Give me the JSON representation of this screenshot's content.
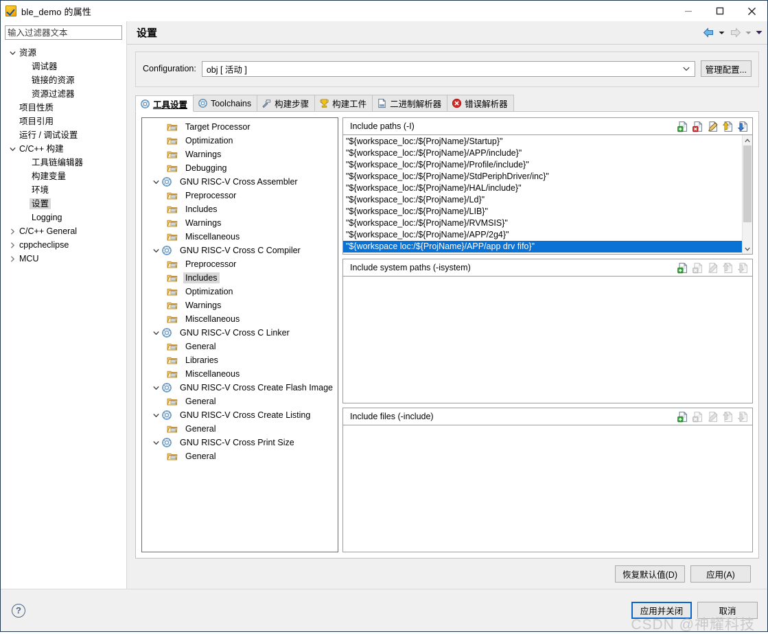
{
  "window": {
    "title": "ble_demo 的属性",
    "app_icon": "checkbox-yellow-icon",
    "minimize_label": "最小化",
    "maximize_label": "最大化",
    "close_label": "关闭"
  },
  "sidebar": {
    "filter_placeholder": "输入过滤器文本",
    "filter_value": "",
    "items": [
      {
        "label": "资源",
        "depth": 0,
        "arrow": "down",
        "selected": false
      },
      {
        "label": "调试器",
        "depth": 1,
        "arrow": "none",
        "selected": false
      },
      {
        "label": "链接的资源",
        "depth": 1,
        "arrow": "none",
        "selected": false
      },
      {
        "label": "资源过滤器",
        "depth": 1,
        "arrow": "none",
        "selected": false
      },
      {
        "label": "项目性质",
        "depth": 0,
        "arrow": "none",
        "selected": false
      },
      {
        "label": "项目引用",
        "depth": 0,
        "arrow": "none",
        "selected": false
      },
      {
        "label": "运行 / 调试设置",
        "depth": 0,
        "arrow": "none",
        "selected": false
      },
      {
        "label": "C/C++ 构建",
        "depth": 0,
        "arrow": "down",
        "selected": false
      },
      {
        "label": "工具链编辑器",
        "depth": 1,
        "arrow": "none",
        "selected": false
      },
      {
        "label": "构建变量",
        "depth": 1,
        "arrow": "none",
        "selected": false
      },
      {
        "label": "环境",
        "depth": 1,
        "arrow": "none",
        "selected": false
      },
      {
        "label": "设置",
        "depth": 1,
        "arrow": "none",
        "selected": true
      },
      {
        "label": "Logging",
        "depth": 1,
        "arrow": "none",
        "selected": false
      },
      {
        "label": "C/C++ General",
        "depth": 0,
        "arrow": "right",
        "selected": false
      },
      {
        "label": "cppcheclipse",
        "depth": 0,
        "arrow": "right",
        "selected": false
      },
      {
        "label": "MCU",
        "depth": 0,
        "arrow": "right",
        "selected": false
      }
    ]
  },
  "page": {
    "title": "设置",
    "nav_back": "back-arrow-icon",
    "nav_forward": "forward-arrow-icon",
    "nav_menu": "dropdown-caret-icon"
  },
  "configuration": {
    "label": "Configuration:",
    "value": "obj  [ 活动 ]",
    "manage_label": "管理配置..."
  },
  "tabs": [
    {
      "label": "工具设置",
      "icon": "gear-wrench-icon",
      "active": true
    },
    {
      "label": "Toolchains",
      "icon": "gear-wrench-icon",
      "active": false
    },
    {
      "label": "构建步骤",
      "icon": "hammer-icon",
      "active": false
    },
    {
      "label": "构建工件",
      "icon": "trophy-icon",
      "active": false
    },
    {
      "label": "二进制解析器",
      "icon": "binary-file-icon",
      "active": false
    },
    {
      "label": "错误解析器",
      "icon": "error-circle-icon",
      "active": false
    }
  ],
  "tool_tree": [
    {
      "label": "Target Processor",
      "depth": 1,
      "icon": "folder-icon",
      "twisty": "none",
      "selected": false
    },
    {
      "label": "Optimization",
      "depth": 1,
      "icon": "folder-icon",
      "twisty": "none",
      "selected": false
    },
    {
      "label": "Warnings",
      "depth": 1,
      "icon": "folder-icon",
      "twisty": "none",
      "selected": false
    },
    {
      "label": "Debugging",
      "depth": 1,
      "icon": "folder-icon",
      "twisty": "none",
      "selected": false
    },
    {
      "label": "GNU RISC-V Cross Assembler",
      "depth": 0,
      "icon": "gear-wrench-icon",
      "twisty": "down",
      "selected": false
    },
    {
      "label": "Preprocessor",
      "depth": 1,
      "icon": "folder-icon",
      "twisty": "none",
      "selected": false
    },
    {
      "label": "Includes",
      "depth": 1,
      "icon": "folder-icon",
      "twisty": "none",
      "selected": false
    },
    {
      "label": "Warnings",
      "depth": 1,
      "icon": "folder-icon",
      "twisty": "none",
      "selected": false
    },
    {
      "label": "Miscellaneous",
      "depth": 1,
      "icon": "folder-icon",
      "twisty": "none",
      "selected": false
    },
    {
      "label": "GNU RISC-V Cross C Compiler",
      "depth": 0,
      "icon": "gear-wrench-icon",
      "twisty": "down",
      "selected": false
    },
    {
      "label": "Preprocessor",
      "depth": 1,
      "icon": "folder-icon",
      "twisty": "none",
      "selected": false
    },
    {
      "label": "Includes",
      "depth": 1,
      "icon": "folder-icon",
      "twisty": "none",
      "selected": true
    },
    {
      "label": "Optimization",
      "depth": 1,
      "icon": "folder-icon",
      "twisty": "none",
      "selected": false
    },
    {
      "label": "Warnings",
      "depth": 1,
      "icon": "folder-icon",
      "twisty": "none",
      "selected": false
    },
    {
      "label": "Miscellaneous",
      "depth": 1,
      "icon": "folder-icon",
      "twisty": "none",
      "selected": false
    },
    {
      "label": "GNU RISC-V Cross C Linker",
      "depth": 0,
      "icon": "gear-wrench-icon",
      "twisty": "down",
      "selected": false
    },
    {
      "label": "General",
      "depth": 1,
      "icon": "folder-icon",
      "twisty": "none",
      "selected": false
    },
    {
      "label": "Libraries",
      "depth": 1,
      "icon": "folder-icon",
      "twisty": "none",
      "selected": false
    },
    {
      "label": "Miscellaneous",
      "depth": 1,
      "icon": "folder-icon",
      "twisty": "none",
      "selected": false
    },
    {
      "label": "GNU RISC-V Cross Create Flash Image",
      "depth": 0,
      "icon": "gear-wrench-icon",
      "twisty": "down",
      "selected": false
    },
    {
      "label": "General",
      "depth": 1,
      "icon": "folder-icon",
      "twisty": "none",
      "selected": false
    },
    {
      "label": "GNU RISC-V Cross Create Listing",
      "depth": 0,
      "icon": "gear-wrench-icon",
      "twisty": "down",
      "selected": false
    },
    {
      "label": "General",
      "depth": 1,
      "icon": "folder-icon",
      "twisty": "none",
      "selected": false
    },
    {
      "label": "GNU RISC-V Cross Print Size",
      "depth": 0,
      "icon": "gear-wrench-icon",
      "twisty": "down",
      "selected": false
    },
    {
      "label": "General",
      "depth": 1,
      "icon": "folder-icon",
      "twisty": "none",
      "selected": false
    }
  ],
  "groups": [
    {
      "title": "Include paths (-I)",
      "tools_enabled": true,
      "items": [
        {
          "text": "\"${workspace_loc:/${ProjName}/Startup}\"",
          "selected": false
        },
        {
          "text": "\"${workspace_loc:/${ProjName}/APP/include}\"",
          "selected": false
        },
        {
          "text": "\"${workspace_loc:/${ProjName}/Profile/include}\"",
          "selected": false
        },
        {
          "text": "\"${workspace_loc:/${ProjName}/StdPeriphDriver/inc}\"",
          "selected": false
        },
        {
          "text": "\"${workspace_loc:/${ProjName}/HAL/include}\"",
          "selected": false
        },
        {
          "text": "\"${workspace_loc:/${ProjName}/Ld}\"",
          "selected": false
        },
        {
          "text": "\"${workspace_loc:/${ProjName}/LIB}\"",
          "selected": false
        },
        {
          "text": "\"${workspace_loc:/${ProjName}/RVMSIS}\"",
          "selected": false
        },
        {
          "text": "\"${workspace_loc:/${ProjName}/APP/2g4}\"",
          "selected": false
        },
        {
          "text": "\"${workspace loc:/${ProjName}/APP/app drv fifo}\"",
          "selected": true
        }
      ],
      "scrollbar": true
    },
    {
      "title": "Include system paths (-isystem)",
      "tools_enabled": false,
      "items": [],
      "scrollbar": false
    },
    {
      "title": "Include files (-include)",
      "tools_enabled": false,
      "items": [],
      "scrollbar": false
    }
  ],
  "group_tools": [
    {
      "name": "add-icon",
      "label": "添加"
    },
    {
      "name": "delete-icon",
      "label": "删除"
    },
    {
      "name": "edit-icon",
      "label": "编辑"
    },
    {
      "name": "move-up-icon",
      "label": "上移"
    },
    {
      "name": "move-down-icon",
      "label": "下移"
    }
  ],
  "footer": {
    "restore_defaults": "恢复默认值(D)",
    "apply": "应用(A)"
  },
  "dialog_bottom": {
    "help": "?",
    "apply_and_close": "应用并关闭",
    "cancel": "取消",
    "watermark": "CSDN @神耀科技"
  },
  "colors": {
    "selection_blue": "#0a72d4",
    "default_button_border": "#0a64c8",
    "dialog_bg": "#f0f0f0",
    "tree_selection_grey": "#d8d8d8"
  }
}
